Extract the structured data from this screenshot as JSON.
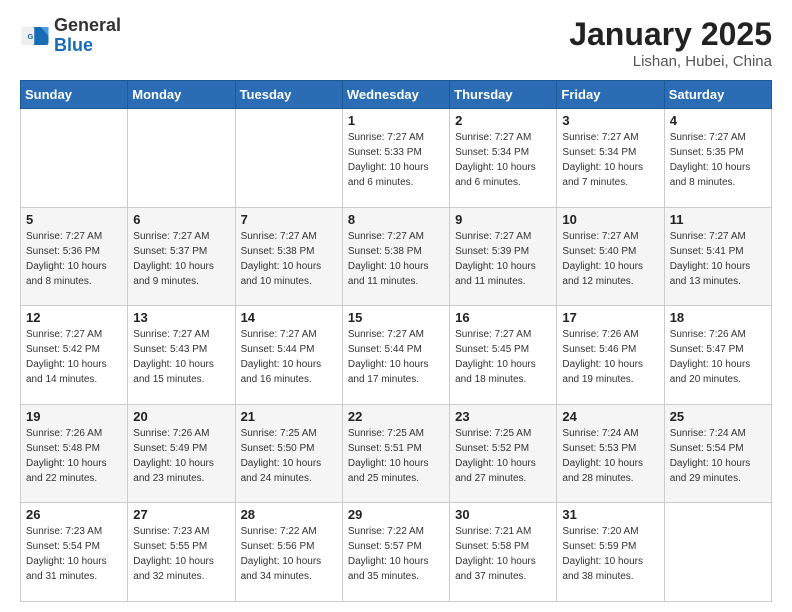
{
  "header": {
    "logo": {
      "general": "General",
      "blue": "Blue"
    },
    "title": "January 2025",
    "location": "Lishan, Hubei, China"
  },
  "weekdays": [
    "Sunday",
    "Monday",
    "Tuesday",
    "Wednesday",
    "Thursday",
    "Friday",
    "Saturday"
  ],
  "weeks": [
    [
      {
        "day": "",
        "info": ""
      },
      {
        "day": "",
        "info": ""
      },
      {
        "day": "",
        "info": ""
      },
      {
        "day": "1",
        "info": "Sunrise: 7:27 AM\nSunset: 5:33 PM\nDaylight: 10 hours\nand 6 minutes."
      },
      {
        "day": "2",
        "info": "Sunrise: 7:27 AM\nSunset: 5:34 PM\nDaylight: 10 hours\nand 6 minutes."
      },
      {
        "day": "3",
        "info": "Sunrise: 7:27 AM\nSunset: 5:34 PM\nDaylight: 10 hours\nand 7 minutes."
      },
      {
        "day": "4",
        "info": "Sunrise: 7:27 AM\nSunset: 5:35 PM\nDaylight: 10 hours\nand 8 minutes."
      }
    ],
    [
      {
        "day": "5",
        "info": "Sunrise: 7:27 AM\nSunset: 5:36 PM\nDaylight: 10 hours\nand 8 minutes."
      },
      {
        "day": "6",
        "info": "Sunrise: 7:27 AM\nSunset: 5:37 PM\nDaylight: 10 hours\nand 9 minutes."
      },
      {
        "day": "7",
        "info": "Sunrise: 7:27 AM\nSunset: 5:38 PM\nDaylight: 10 hours\nand 10 minutes."
      },
      {
        "day": "8",
        "info": "Sunrise: 7:27 AM\nSunset: 5:38 PM\nDaylight: 10 hours\nand 11 minutes."
      },
      {
        "day": "9",
        "info": "Sunrise: 7:27 AM\nSunset: 5:39 PM\nDaylight: 10 hours\nand 11 minutes."
      },
      {
        "day": "10",
        "info": "Sunrise: 7:27 AM\nSunset: 5:40 PM\nDaylight: 10 hours\nand 12 minutes."
      },
      {
        "day": "11",
        "info": "Sunrise: 7:27 AM\nSunset: 5:41 PM\nDaylight: 10 hours\nand 13 minutes."
      }
    ],
    [
      {
        "day": "12",
        "info": "Sunrise: 7:27 AM\nSunset: 5:42 PM\nDaylight: 10 hours\nand 14 minutes."
      },
      {
        "day": "13",
        "info": "Sunrise: 7:27 AM\nSunset: 5:43 PM\nDaylight: 10 hours\nand 15 minutes."
      },
      {
        "day": "14",
        "info": "Sunrise: 7:27 AM\nSunset: 5:44 PM\nDaylight: 10 hours\nand 16 minutes."
      },
      {
        "day": "15",
        "info": "Sunrise: 7:27 AM\nSunset: 5:44 PM\nDaylight: 10 hours\nand 17 minutes."
      },
      {
        "day": "16",
        "info": "Sunrise: 7:27 AM\nSunset: 5:45 PM\nDaylight: 10 hours\nand 18 minutes."
      },
      {
        "day": "17",
        "info": "Sunrise: 7:26 AM\nSunset: 5:46 PM\nDaylight: 10 hours\nand 19 minutes."
      },
      {
        "day": "18",
        "info": "Sunrise: 7:26 AM\nSunset: 5:47 PM\nDaylight: 10 hours\nand 20 minutes."
      }
    ],
    [
      {
        "day": "19",
        "info": "Sunrise: 7:26 AM\nSunset: 5:48 PM\nDaylight: 10 hours\nand 22 minutes."
      },
      {
        "day": "20",
        "info": "Sunrise: 7:26 AM\nSunset: 5:49 PM\nDaylight: 10 hours\nand 23 minutes."
      },
      {
        "day": "21",
        "info": "Sunrise: 7:25 AM\nSunset: 5:50 PM\nDaylight: 10 hours\nand 24 minutes."
      },
      {
        "day": "22",
        "info": "Sunrise: 7:25 AM\nSunset: 5:51 PM\nDaylight: 10 hours\nand 25 minutes."
      },
      {
        "day": "23",
        "info": "Sunrise: 7:25 AM\nSunset: 5:52 PM\nDaylight: 10 hours\nand 27 minutes."
      },
      {
        "day": "24",
        "info": "Sunrise: 7:24 AM\nSunset: 5:53 PM\nDaylight: 10 hours\nand 28 minutes."
      },
      {
        "day": "25",
        "info": "Sunrise: 7:24 AM\nSunset: 5:54 PM\nDaylight: 10 hours\nand 29 minutes."
      }
    ],
    [
      {
        "day": "26",
        "info": "Sunrise: 7:23 AM\nSunset: 5:54 PM\nDaylight: 10 hours\nand 31 minutes."
      },
      {
        "day": "27",
        "info": "Sunrise: 7:23 AM\nSunset: 5:55 PM\nDaylight: 10 hours\nand 32 minutes."
      },
      {
        "day": "28",
        "info": "Sunrise: 7:22 AM\nSunset: 5:56 PM\nDaylight: 10 hours\nand 34 minutes."
      },
      {
        "day": "29",
        "info": "Sunrise: 7:22 AM\nSunset: 5:57 PM\nDaylight: 10 hours\nand 35 minutes."
      },
      {
        "day": "30",
        "info": "Sunrise: 7:21 AM\nSunset: 5:58 PM\nDaylight: 10 hours\nand 37 minutes."
      },
      {
        "day": "31",
        "info": "Sunrise: 7:20 AM\nSunset: 5:59 PM\nDaylight: 10 hours\nand 38 minutes."
      },
      {
        "day": "",
        "info": ""
      }
    ]
  ]
}
